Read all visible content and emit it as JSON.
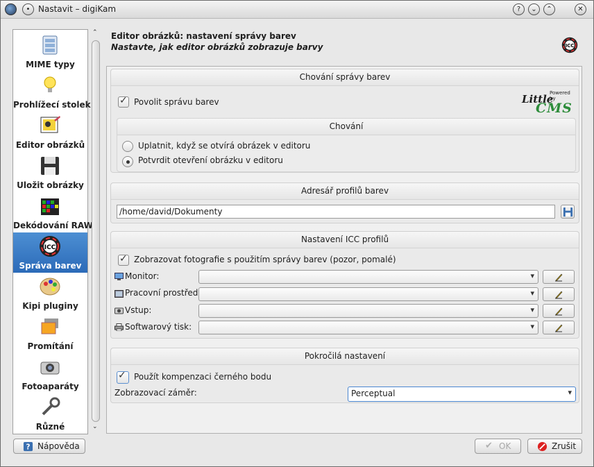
{
  "window": {
    "title": "Nastavit – digiKam",
    "accent": "#2f6fbf"
  },
  "sidebar": {
    "items": [
      {
        "label": "MIME typy",
        "icon": "mime-types-icon"
      },
      {
        "label": "Prohlížecí stolek",
        "icon": "light-table-icon"
      },
      {
        "label": "Editor obrázků",
        "icon": "image-editor-icon"
      },
      {
        "label": "Uložit obrázky",
        "icon": "save-images-icon"
      },
      {
        "label": "Dekódování RAW",
        "icon": "raw-decoding-icon"
      },
      {
        "label": "Správa barev",
        "icon": "color-management-icon",
        "selected": true
      },
      {
        "label": "Kipi pluginy",
        "icon": "kipi-plugins-icon"
      },
      {
        "label": "Promítání",
        "icon": "slideshow-icon"
      },
      {
        "label": "Fotoaparáty",
        "icon": "cameras-icon"
      },
      {
        "label": "Různé",
        "icon": "misc-icon"
      }
    ]
  },
  "header": {
    "title": "Editor obrázků: nastavení správy barev",
    "subtitle": "Nastavte, jak editor obrázků zobrazuje barvy"
  },
  "behavior_group": {
    "title": "Chování správy barev",
    "enable_label": "Povolit správu barev",
    "enable_checked": true,
    "lcms_powered": "Powered by",
    "lcms_little": "Little",
    "lcms_cms": "CMS",
    "inner_title": "Chování",
    "radio_apply": "Uplatnit, když se otvírá obrázek v editoru",
    "radio_confirm": "Potvrdit otevření obrázku v editoru",
    "selected_radio": "confirm"
  },
  "profile_dir_group": {
    "title": "Adresář profilů barev",
    "path": "/home/david/Dokumenty"
  },
  "icc_group": {
    "title": "Nastavení ICC profilů",
    "show_label": "Zobrazovat fotografie s použitím správy barev (pozor, pomalé)",
    "show_checked": true,
    "rows": [
      {
        "label": "Monitor:",
        "icon": "monitor-icon",
        "value": ""
      },
      {
        "label": "Pracovní prostředí:",
        "icon": "workspace-icon",
        "value": ""
      },
      {
        "label": "Vstup:",
        "icon": "input-camera-icon",
        "value": ""
      },
      {
        "label": "Softwarový tisk:",
        "icon": "printer-icon",
        "value": ""
      }
    ]
  },
  "advanced_group": {
    "title": "Pokročilá nastavení",
    "bpc_label": "Použít kompenzaci černého bodu",
    "bpc_checked": true,
    "intent_label": "Zobrazovací záměr:",
    "intent_value": "Perceptual"
  },
  "buttons": {
    "help": "Nápověda",
    "ok": "OK",
    "cancel": "Zrušit"
  }
}
